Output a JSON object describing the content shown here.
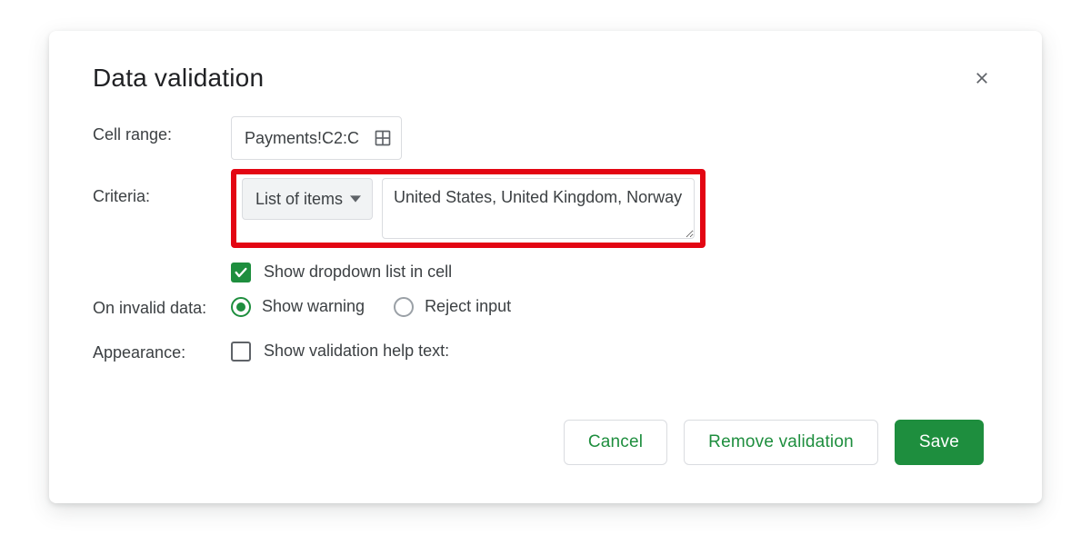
{
  "dialog": {
    "title": "Data validation"
  },
  "labels": {
    "cell_range": "Cell range:",
    "criteria": "Criteria:",
    "on_invalid": "On invalid data:",
    "appearance": "Appearance:"
  },
  "cell_range": {
    "value": "Payments!C2:C"
  },
  "criteria": {
    "type_label": "List of items",
    "items_value": "United States, United Kingdom, Norway"
  },
  "options": {
    "show_dropdown_label": "Show dropdown list in cell",
    "show_dropdown_checked": true,
    "show_warning_label": "Show warning",
    "reject_input_label": "Reject input",
    "on_invalid_selected": "show_warning",
    "show_help_text_label": "Show validation help text:",
    "show_help_text_checked": false
  },
  "buttons": {
    "cancel": "Cancel",
    "remove": "Remove validation",
    "save": "Save"
  },
  "highlight": {
    "color": "#e30613"
  },
  "colors": {
    "accent": "#1e8e3e"
  }
}
